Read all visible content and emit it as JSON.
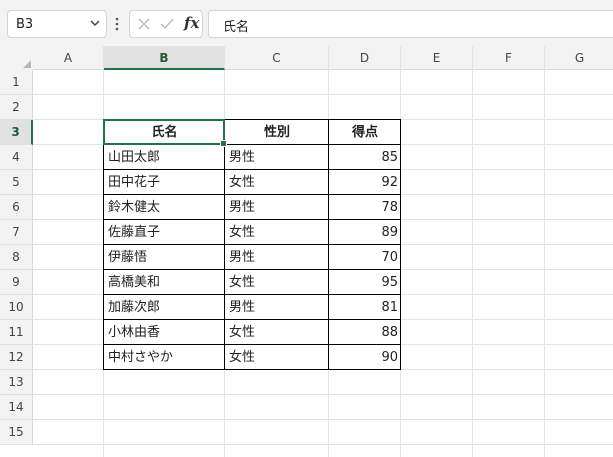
{
  "name_box": {
    "value": "B3"
  },
  "formula_bar": {
    "fx_label": "fx",
    "content": "氏名"
  },
  "columns": [
    "A",
    "B",
    "C",
    "D",
    "E",
    "F",
    "G"
  ],
  "rows": [
    "1",
    "2",
    "3",
    "4",
    "5",
    "6",
    "7",
    "8",
    "9",
    "10",
    "11",
    "12",
    "13",
    "14",
    "15"
  ],
  "selected": {
    "column": "B",
    "row": "3"
  },
  "table": {
    "headers": [
      "氏名",
      "性別",
      "得点"
    ],
    "rows": [
      [
        "山田太郎",
        "男性",
        "85"
      ],
      [
        "田中花子",
        "女性",
        "92"
      ],
      [
        "鈴木健太",
        "男性",
        "78"
      ],
      [
        "佐藤直子",
        "女性",
        "89"
      ],
      [
        "伊藤悟",
        "男性",
        "70"
      ],
      [
        "高橋美和",
        "女性",
        "95"
      ],
      [
        "加藤次郎",
        "男性",
        "81"
      ],
      [
        "小林由香",
        "女性",
        "88"
      ],
      [
        "中村さやか",
        "女性",
        "90"
      ]
    ]
  },
  "colors": {
    "accent": "#217346"
  }
}
